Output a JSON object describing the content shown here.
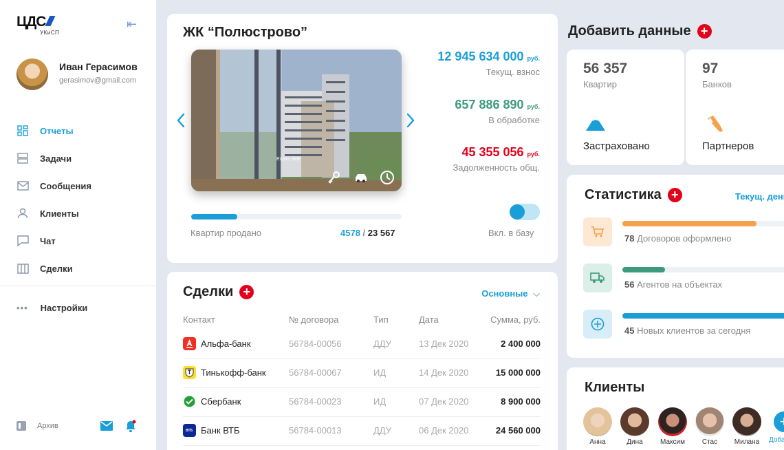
{
  "brand": {
    "name": "ЦДС",
    "sub": "УКиСП"
  },
  "user": {
    "name": "Иван Герасимов",
    "email": "gerasimov@gmail.com"
  },
  "nav": {
    "items": [
      {
        "label": "Отчеты",
        "icon": "dashboard-icon"
      },
      {
        "label": "Задачи",
        "icon": "tasks-icon"
      },
      {
        "label": "Сообщения",
        "icon": "mail-icon"
      },
      {
        "label": "Клиенты",
        "icon": "user-icon"
      },
      {
        "label": "Чат",
        "icon": "chat-icon"
      },
      {
        "label": "Сделки",
        "icon": "deals-icon"
      }
    ],
    "settings": "Настройки",
    "archive": "Архив"
  },
  "project": {
    "title": "ЖК “Полюстрово”",
    "photo_caption": "Expire date",
    "money": [
      {
        "value": "12 945 634 000",
        "unit": "руб.",
        "label": "Текущ. взнос",
        "color": "#1a9ed8"
      },
      {
        "value": "657 886 890",
        "unit": "руб.",
        "label": "В обработке",
        "color": "#3e9a7c"
      },
      {
        "value": "45 355 056",
        "unit": "руб.",
        "label": "Задолженность общ.",
        "color": "#e2001a"
      }
    ],
    "sold_label": "Квартир продано",
    "sold_current": "4578",
    "sold_sep": " / ",
    "sold_total": "23 567",
    "sold_fraction": 0.22,
    "toggle_label": "Вкл. в базу"
  },
  "deals": {
    "title": "Сделки",
    "filter": "Основные",
    "columns": [
      "Контакт",
      "№ договора",
      "Тип",
      "Дата",
      "Сумма, руб."
    ],
    "rows": [
      {
        "contact": "Альфа-банк",
        "number": "56784-00056",
        "type": "ДДУ",
        "date": "13 Дек 2020",
        "sum": "2 400 000"
      },
      {
        "contact": "Тинькофф-банк",
        "number": "56784-00067",
        "type": "ИД",
        "date": "14 Дек 2020",
        "sum": "15 000 000"
      },
      {
        "contact": "Сбербанк",
        "number": "56784-00023",
        "type": "ИД",
        "date": "07 Дек 2020",
        "sum": "8 900 000"
      },
      {
        "contact": "Банк ВТБ",
        "number": "56784-00013",
        "type": "ДДУ",
        "date": "06 Дек 2020",
        "sum": "24 560 000"
      }
    ],
    "bank_logos": [
      "ВТБ"
    ]
  },
  "add_data": {
    "title": "Добавить данные",
    "cards": [
      {
        "num": "56 357",
        "sub": "Квартир",
        "label": "Застраховано"
      },
      {
        "num": "97",
        "sub": "Банков",
        "label": "Партнеров"
      }
    ]
  },
  "stats": {
    "title": "Статистика",
    "filter": "Текущ. день",
    "rows": [
      {
        "num": "78",
        "label": "Договоров оформлено",
        "fraction": 0.75,
        "color": "#f5a04a"
      },
      {
        "num": "56",
        "label": "Агентов на объектах",
        "fraction": 0.24,
        "color": "#3e9a7c"
      },
      {
        "num": "45",
        "label": "Новых клиентов за сегодня",
        "fraction": 0.95,
        "color": "#1a9ed8"
      }
    ]
  },
  "clients": {
    "title": "Клиенты",
    "people": [
      "Анна",
      "Дина",
      "Максим",
      "Стас",
      "Милана"
    ],
    "add": "Добавить"
  }
}
